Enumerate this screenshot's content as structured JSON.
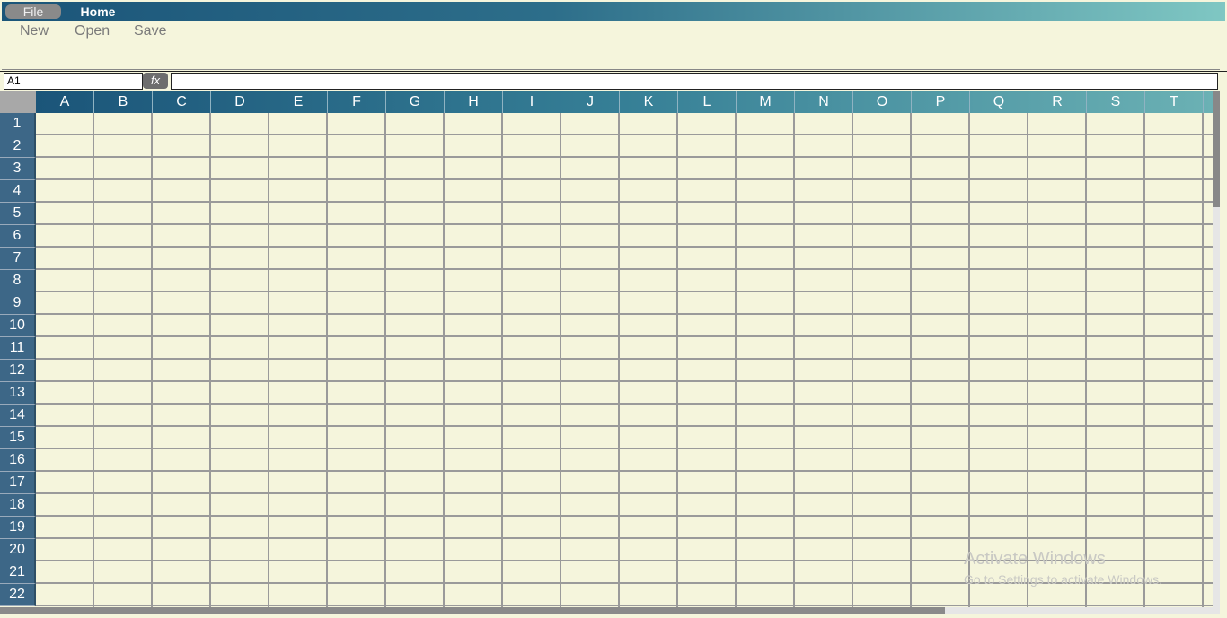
{
  "menubar": {
    "tabs": [
      {
        "label": "File"
      },
      {
        "label": "Home"
      }
    ]
  },
  "ribbon": {
    "buttons": [
      {
        "label": "New"
      },
      {
        "label": "Open"
      },
      {
        "label": "Save"
      }
    ]
  },
  "formula_bar": {
    "name_box_value": "A1",
    "fx_label": "fx",
    "formula_value": ""
  },
  "grid": {
    "columns": [
      "A",
      "B",
      "C",
      "D",
      "E",
      "F",
      "G",
      "H",
      "I",
      "J",
      "K",
      "L",
      "M",
      "N",
      "O",
      "P",
      "Q",
      "R",
      "S",
      "T"
    ],
    "rows": [
      "1",
      "2",
      "3",
      "4",
      "5",
      "6",
      "7",
      "8",
      "9",
      "10",
      "11",
      "12",
      "13",
      "14",
      "15",
      "16",
      "17",
      "18",
      "19",
      "20",
      "21",
      "22"
    ]
  },
  "watermark": {
    "line1": "Activate Windows",
    "line2": "Go to Settings to activate Windows."
  },
  "colors": {
    "menubar_start": "#1b5579",
    "menubar_end": "#7fc7c3",
    "sheet_bg": "#f5f5dc",
    "row_header": "#3d6787"
  }
}
